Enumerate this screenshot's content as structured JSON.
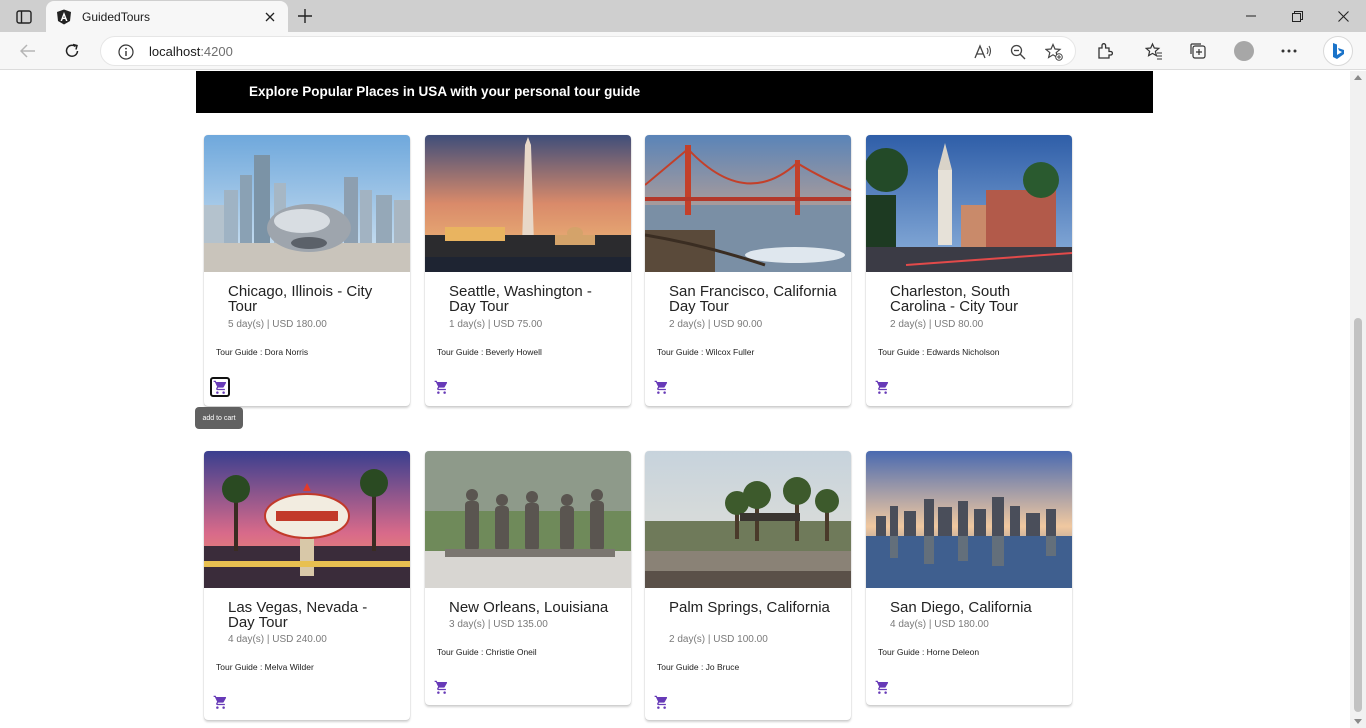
{
  "browser": {
    "tab_title": "GuidedTours",
    "url_host": "localhost",
    "url_port": ":4200"
  },
  "banner": {
    "text": "Explore Popular Places in USA with your personal tour guide"
  },
  "colors": {
    "accent": "#673ab7",
    "banner_bg": "#000000",
    "tooltip_bg": "#616161"
  },
  "tooltip": "add to cart",
  "tours": [
    {
      "title": "Chicago, Illinois - City Tour",
      "days": "5 day(s) | USD 180.00",
      "guide": "Tour Guide : Dora Norris",
      "icon": "cart-icon"
    },
    {
      "title": "Seattle, Washington - Day Tour",
      "days": "1 day(s) | USD 75.00",
      "guide": "Tour Guide : Beverly Howell",
      "icon": "cart-icon"
    },
    {
      "title": "San Francisco, California Day Tour",
      "days": "2 day(s) | USD 90.00",
      "guide": "Tour Guide : Wilcox Fuller",
      "icon": "cart-icon"
    },
    {
      "title": "Charleston, South Carolina - City Tour",
      "days": "2 day(s) | USD 80.00",
      "guide": "Tour Guide : Edwards Nicholson",
      "icon": "cart-icon"
    },
    {
      "title": "Las Vegas, Nevada - Day Tour",
      "days": "4 day(s) | USD 240.00",
      "guide": "Tour Guide : Melva Wilder",
      "icon": "cart-icon"
    },
    {
      "title": "New Orleans, Louisiana",
      "days": "3 day(s) | USD 135.00",
      "guide": "Tour Guide : Christie Oneil",
      "icon": "cart-icon"
    },
    {
      "title": "Palm Springs, California",
      "days": "2 day(s) | USD 100.00",
      "guide": "Tour Guide : Jo Bruce",
      "icon": "cart-icon"
    },
    {
      "title": "San Diego, California",
      "days": "4 day(s) | USD 180.00",
      "guide": "Tour Guide : Horne Deleon",
      "icon": "cart-icon"
    }
  ]
}
